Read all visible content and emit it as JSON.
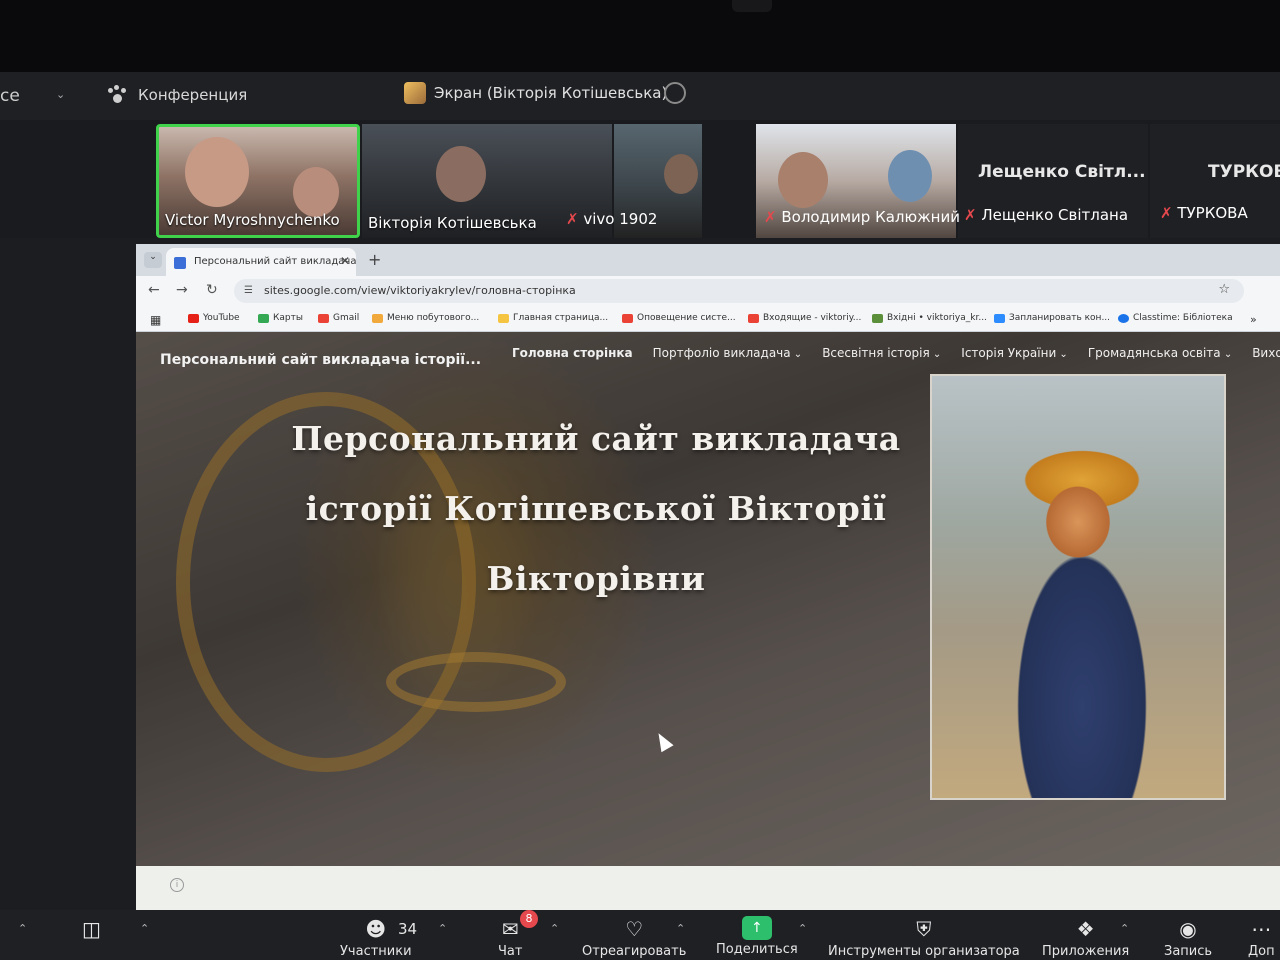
{
  "zoom": {
    "topbar": {
      "left_stub": "ce",
      "conference_label": "Конференция",
      "screen_share_title": "Экран (Вікторія Котішевська)"
    },
    "participants": [
      {
        "name": "Victor Myroshnychenko",
        "muted": false,
        "active": true
      },
      {
        "name": "Вікторія Котішевська",
        "muted": false,
        "active": false
      },
      {
        "name": "vivo 1902",
        "muted": true,
        "active": false
      },
      {
        "name": "Володимир Калюжний",
        "muted": true,
        "active": false
      },
      {
        "name": "Лещенко Світлана",
        "display_name": "Лещенко Світл...",
        "muted": true,
        "active": false
      },
      {
        "name": "ТУРКОВА",
        "display_name": "ТУРКОВ",
        "muted": true,
        "active": false
      }
    ],
    "toolbar": {
      "participants_count": "34",
      "participants_label": "Участники",
      "chat_label": "Чат",
      "chat_badge": "8",
      "react_label": "Отреагировать",
      "share_label": "Поделиться",
      "host_tools_label": "Инструменты организатора",
      "apps_label": "Приложения",
      "record_label": "Запись",
      "more_label": "Доп"
    }
  },
  "browser": {
    "tab_title": "Персональний сайт викладача",
    "url": "sites.google.com/view/viktoriyakrylev/головна-сторінка",
    "bookmarks": [
      {
        "label": "YouTube",
        "color": "#e62117"
      },
      {
        "label": "Карты",
        "color": "#34a853"
      },
      {
        "label": "Gmail",
        "color": "#ea4335"
      },
      {
        "label": "Меню побутового...",
        "color": "#f2a93b"
      },
      {
        "label": "Главная страница...",
        "color": "#f5c542"
      },
      {
        "label": "Оповещение систе...",
        "color": "#ea4335"
      },
      {
        "label": "Входящие - viktoriy...",
        "color": "#ea4335"
      },
      {
        "label": "Вхідні • viktoriya_kr...",
        "color": "#5c8f3a"
      },
      {
        "label": "Запланировать кон...",
        "color": "#2d8cff"
      },
      {
        "label": "Classtime: Бібліотека",
        "color": "#1a73e8"
      }
    ]
  },
  "site": {
    "brand": "Персональний сайт викладача історії...",
    "nav": [
      {
        "label": "Головна сторінка",
        "dropdown": false,
        "active": true
      },
      {
        "label": "Портфоліо викладача",
        "dropdown": true,
        "active": false
      },
      {
        "label": "Всесвітня історія",
        "dropdown": true,
        "active": false
      },
      {
        "label": "Історія України",
        "dropdown": true,
        "active": false
      },
      {
        "label": "Громадянська освіта",
        "dropdown": true,
        "active": false
      },
      {
        "label": "Виховна р",
        "dropdown": false,
        "active": false
      }
    ],
    "hero_lines": [
      "Персональний сайт викладача",
      "історії Котішевської Вікторії",
      "Вікторівни"
    ]
  }
}
